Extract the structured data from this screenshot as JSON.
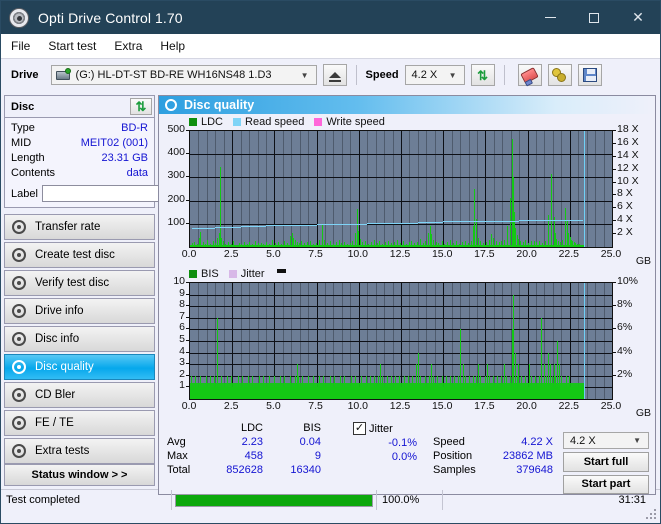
{
  "window": {
    "title": "Opti Drive Control 1.70",
    "icon": "disc-icon",
    "minimize": "–",
    "maximize": "□",
    "close": "✕"
  },
  "menu": [
    "File",
    "Start test",
    "Extra",
    "Help"
  ],
  "toolbar": {
    "drive_label": "Drive",
    "drive_value": "(G:)  HL-DT-ST BD-RE  WH16NS48 1.D3",
    "eject_icon": "eject-icon",
    "speed_label": "Speed",
    "speed_value": "4.2 X",
    "refresh_icon": "refresh-icon",
    "eraser_icon": "eraser-icon",
    "gear_icon": "gear-icon",
    "save_icon": "floppy-save-icon"
  },
  "disc_panel": {
    "header": "Disc",
    "refresh_icon": "refresh-icon",
    "rows": [
      {
        "key": "Type",
        "value": "BD-R"
      },
      {
        "key": "MID",
        "value": "MEIT02 (001)"
      },
      {
        "key": "Length",
        "value": "23.31 GB"
      },
      {
        "key": "Contents",
        "value": "data"
      }
    ],
    "label_key": "Label",
    "label_value": "",
    "disc_icon": "cd-disc-icon"
  },
  "sidebar": {
    "items": [
      {
        "label": "Transfer rate",
        "icon": "disc-icon",
        "active": false
      },
      {
        "label": "Create test disc",
        "icon": "disc-icon",
        "active": false
      },
      {
        "label": "Verify test disc",
        "icon": "disc-icon",
        "active": false
      },
      {
        "label": "Drive info",
        "icon": "disc-icon",
        "active": false
      },
      {
        "label": "Disc info",
        "icon": "disc-icon",
        "active": false
      },
      {
        "label": "Disc quality",
        "icon": "disc-icon",
        "active": true
      },
      {
        "label": "CD Bler",
        "icon": "disc-icon",
        "active": false
      },
      {
        "label": "FE / TE",
        "icon": "disc-icon",
        "active": false
      },
      {
        "label": "Extra tests",
        "icon": "disc-icon",
        "active": false
      }
    ],
    "status_window": "Status window > >"
  },
  "panel": {
    "title": "Disc quality",
    "icon": "disc-quality-icon"
  },
  "stats": {
    "col_headers": [
      "LDC",
      "BIS"
    ],
    "rows": [
      {
        "label": "Avg",
        "ldc": "2.23",
        "bis": "0.04"
      },
      {
        "label": "Max",
        "ldc": "458",
        "bis": "9"
      },
      {
        "label": "Total",
        "ldc": "852628",
        "bis": "16340"
      }
    ],
    "jitter_checked": true,
    "jitter_label": "Jitter",
    "jitter_values": [
      "-0.1%",
      "0.0%"
    ],
    "speed_key": "Speed",
    "speed_value": "4.22 X",
    "position_key": "Position",
    "position_value": "23862 MB",
    "samples_key": "Samples",
    "samples_value": "379648",
    "speed_select": "4.2 X",
    "start_full": "Start full",
    "start_part": "Start part"
  },
  "statusbar": {
    "message": "Test completed",
    "progress_percent_label": "100.0%",
    "progress_percent": 100,
    "elapsed": "31:31"
  },
  "chart_data": [
    {
      "type": "bar",
      "name": "ldc-chart",
      "title": "",
      "legend": [
        {
          "label": "LDC",
          "color": "#0f8f0f"
        },
        {
          "label": "Read speed",
          "color": "#7fd4f7"
        },
        {
          "label": "Write speed",
          "color": "#ff66d9"
        }
      ],
      "xlabel": "GB",
      "ylabel": "",
      "xlim": [
        0,
        25
      ],
      "xticks": [
        "0.0",
        "2.5",
        "5.0",
        "7.5",
        "10.0",
        "12.5",
        "15.0",
        "17.5",
        "20.0",
        "22.5",
        "25.0"
      ],
      "ylim": [
        0,
        500
      ],
      "yticks": [
        "100",
        "200",
        "300",
        "400",
        "500"
      ],
      "y2lim": [
        0,
        18
      ],
      "y2ticks": [
        "2 X",
        "4 X",
        "6 X",
        "8 X",
        "10 X",
        "12 X",
        "14 X",
        "16 X",
        "18 X"
      ],
      "grid": true,
      "series": [
        {
          "name": "LDC",
          "color": "#14c814",
          "x": [
            0.1,
            0.25,
            0.4,
            0.55,
            0.62,
            0.75,
            0.88,
            1.02,
            1.18,
            1.35,
            1.5,
            1.62,
            1.72,
            1.8,
            1.86,
            1.95,
            2.1,
            2.25,
            2.4,
            2.55,
            2.72,
            2.88,
            3.05,
            3.2,
            3.35,
            3.5,
            3.68,
            3.85,
            4.0,
            4.18,
            4.35,
            4.52,
            4.7,
            4.88,
            5.05,
            5.22,
            5.4,
            5.58,
            5.75,
            5.92,
            6.05,
            6.12,
            6.2,
            6.32,
            6.45,
            6.6,
            6.78,
            6.95,
            7.1,
            7.28,
            7.45,
            7.62,
            7.8,
            7.95,
            8.1,
            8.28,
            8.45,
            8.62,
            8.8,
            8.95,
            9.1,
            9.28,
            9.45,
            9.62,
            9.78,
            9.88,
            9.95,
            10.05,
            10.2,
            10.38,
            10.55,
            10.72,
            10.9,
            11.05,
            11.22,
            11.4,
            11.58,
            11.75,
            11.92,
            12.1,
            12.28,
            12.45,
            12.62,
            12.8,
            12.95,
            13.1,
            13.28,
            13.45,
            13.62,
            13.78,
            13.95,
            14.1,
            14.2,
            14.28,
            14.4,
            14.55,
            14.72,
            14.9,
            15.05,
            15.22,
            15.4,
            15.58,
            15.75,
            15.92,
            16.1,
            16.28,
            16.45,
            16.62,
            16.78,
            16.85,
            16.92,
            17.05,
            17.2,
            17.38,
            17.55,
            17.72,
            17.85,
            17.95,
            18.1,
            18.28,
            18.45,
            18.62,
            18.8,
            18.95,
            19.05,
            19.12,
            19.18,
            19.25,
            19.35,
            19.45,
            19.55,
            19.7,
            19.85,
            20.0,
            20.18,
            20.35,
            20.52,
            20.7,
            20.88,
            21.05,
            21.22,
            21.4,
            21.55,
            21.62,
            21.7,
            21.78,
            21.9,
            22.05,
            22.2,
            22.32,
            22.42,
            22.5,
            22.58,
            22.65,
            22.72,
            22.8,
            22.9,
            23.05,
            23.2,
            23.35
          ],
          "y": [
            18,
            22,
            12,
            40,
            65,
            20,
            14,
            30,
            12,
            25,
            18,
            40,
            60,
            345,
            40,
            26,
            14,
            20,
            12,
            24,
            10,
            18,
            12,
            22,
            14,
            20,
            12,
            26,
            16,
            18,
            12,
            22,
            14,
            30,
            18,
            20,
            12,
            24,
            16,
            48,
            62,
            40,
            30,
            22,
            18,
            24,
            16,
            20,
            26,
            14,
            18,
            30,
            95,
            32,
            18,
            24,
            14,
            20,
            30,
            16,
            22,
            14,
            18,
            24,
            60,
            162,
            70,
            34,
            20,
            26,
            14,
            22,
            30,
            18,
            24,
            14,
            20,
            26,
            16,
            22,
            30,
            18,
            24,
            14,
            20,
            28,
            16,
            22,
            34,
            18,
            26,
            60,
            90,
            55,
            30,
            22,
            18,
            26,
            14,
            20,
            30,
            18,
            24,
            14,
            22,
            28,
            16,
            24,
            90,
            250,
            120,
            40,
            26,
            18,
            22,
            30,
            58,
            40,
            26,
            20,
            24,
            32,
            90,
            210,
            465,
            300,
            150,
            80,
            50,
            34,
            26,
            22,
            30,
            18,
            24,
            26,
            20,
            28,
            18,
            24,
            140,
            315,
            130,
            60,
            36,
            26,
            22,
            30,
            170,
            110,
            60,
            42,
            30,
            24,
            20,
            16,
            14,
            12,
            10,
            8,
            6
          ]
        },
        {
          "name": "Read speed",
          "color": "#7fd4f7",
          "x": [
            0.1,
            1.5,
            3.0,
            4.5,
            6.0,
            7.5,
            9.0,
            10.5,
            12.0,
            13.5,
            15.0,
            16.5,
            18.0,
            19.5,
            21.0,
            22.5,
            23.3
          ],
          "y": [
            2.9,
            3.1,
            3.25,
            3.35,
            3.45,
            3.5,
            3.6,
            3.7,
            3.8,
            3.9,
            4.0,
            4.05,
            4.1,
            4.15,
            4.2,
            4.25,
            4.3
          ],
          "axis": "y2"
        }
      ]
    },
    {
      "type": "bar",
      "name": "bis-chart",
      "title": "",
      "legend": [
        {
          "label": "BIS",
          "color": "#0f8f0f"
        },
        {
          "label": "Jitter",
          "color": "#d8b8e8"
        }
      ],
      "xlabel": "GB",
      "ylabel": "",
      "xlim": [
        0,
        25
      ],
      "xticks": [
        "0.0",
        "2.5",
        "5.0",
        "7.5",
        "10.0",
        "12.5",
        "15.0",
        "17.5",
        "20.0",
        "22.5",
        "25.0"
      ],
      "ylim": [
        0,
        10
      ],
      "yticks": [
        "1",
        "2",
        "3",
        "4",
        "5",
        "6",
        "7",
        "8",
        "9",
        "10"
      ],
      "y2lim": [
        0,
        10
      ],
      "y2ticks": [
        "2%",
        "4%",
        "6%",
        "8%",
        "10%"
      ],
      "grid": true,
      "series": [
        {
          "name": "BIS",
          "color": "#14c814",
          "x": [
            0.08,
            0.2,
            0.32,
            0.45,
            0.58,
            0.7,
            0.82,
            0.95,
            1.08,
            1.2,
            1.32,
            1.45,
            1.58,
            1.7,
            1.82,
            1.95,
            2.08,
            2.2,
            2.32,
            2.45,
            2.58,
            2.7,
            2.82,
            2.95,
            3.08,
            3.2,
            3.32,
            3.45,
            3.58,
            3.7,
            3.82,
            3.95,
            4.08,
            4.2,
            4.32,
            4.45,
            4.58,
            4.7,
            4.82,
            4.95,
            5.08,
            5.2,
            5.32,
            5.45,
            5.58,
            5.7,
            5.82,
            5.95,
            6.08,
            6.2,
            6.32,
            6.4,
            6.52,
            6.65,
            6.78,
            6.9,
            7.02,
            7.15,
            7.28,
            7.4,
            7.52,
            7.65,
            7.78,
            7.9,
            8.02,
            8.15,
            8.28,
            8.4,
            8.52,
            8.65,
            8.78,
            8.9,
            9.02,
            9.15,
            9.28,
            9.4,
            9.52,
            9.65,
            9.78,
            9.9,
            10.02,
            10.15,
            10.28,
            10.4,
            10.52,
            10.65,
            10.78,
            10.9,
            11.02,
            11.15,
            11.28,
            11.4,
            11.52,
            11.65,
            11.78,
            11.9,
            12.02,
            12.15,
            12.28,
            12.4,
            12.52,
            12.65,
            12.78,
            12.9,
            13.02,
            13.15,
            13.28,
            13.4,
            13.52,
            13.65,
            13.78,
            13.9,
            14.02,
            14.15,
            14.28,
            14.4,
            14.52,
            14.65,
            14.78,
            14.9,
            15.02,
            15.15,
            15.28,
            15.4,
            15.52,
            15.65,
            15.78,
            15.9,
            16.02,
            16.15,
            16.28,
            16.4,
            16.52,
            16.65,
            16.78,
            16.85,
            16.95,
            17.08,
            17.2,
            17.32,
            17.45,
            17.58,
            17.7,
            17.82,
            17.95,
            18.08,
            18.2,
            18.32,
            18.45,
            18.58,
            18.7,
            18.82,
            18.95,
            19.05,
            19.15,
            19.25,
            19.35,
            19.45,
            19.58,
            19.7,
            19.82,
            19.95,
            20.08,
            20.2,
            20.32,
            20.45,
            20.58,
            20.7,
            20.82,
            20.95,
            21.08,
            21.2,
            21.32,
            21.45,
            21.58,
            21.65,
            21.75,
            21.88,
            22.0,
            22.12,
            22.25,
            22.35,
            22.45,
            22.55,
            22.65,
            22.75,
            22.85,
            22.95,
            23.08,
            23.2,
            23.32
          ],
          "y": [
            2,
            1,
            2,
            1,
            2,
            1,
            1,
            2,
            1,
            2,
            1,
            2,
            7,
            1,
            2,
            1,
            1,
            2,
            1,
            2,
            1,
            1,
            2,
            1,
            2,
            1,
            1,
            2,
            1,
            2,
            1,
            1,
            2,
            1,
            2,
            1,
            1,
            2,
            1,
            2,
            1,
            1,
            2,
            1,
            2,
            1,
            1,
            2,
            1,
            2,
            3,
            2,
            1,
            2,
            1,
            1,
            2,
            1,
            2,
            1,
            1,
            2,
            1,
            2,
            1,
            1,
            2,
            1,
            2,
            1,
            1,
            2,
            1,
            2,
            1,
            1,
            2,
            1,
            2,
            1,
            1,
            2,
            1,
            2,
            1,
            2,
            1,
            2,
            1,
            2,
            3,
            2,
            1,
            2,
            1,
            2,
            1,
            2,
            1,
            2,
            1,
            2,
            1,
            2,
            1,
            2,
            1,
            3,
            4,
            2,
            1,
            2,
            1,
            2,
            3,
            2,
            1,
            2,
            1,
            2,
            1,
            2,
            1,
            2,
            1,
            2,
            1,
            2,
            6,
            3,
            2,
            1,
            2,
            1,
            2,
            1,
            2,
            3,
            2,
            1,
            2,
            3,
            2,
            1,
            2,
            1,
            2,
            1,
            2,
            3,
            2,
            1,
            2,
            6,
            9,
            4,
            2,
            3,
            2,
            1,
            2,
            1,
            3,
            2,
            1,
            2,
            1,
            2,
            7,
            3,
            2,
            4,
            3,
            2,
            3,
            2,
            5,
            3,
            2,
            1,
            2,
            1,
            2,
            1,
            1,
            1
          ]
        }
      ]
    }
  ]
}
